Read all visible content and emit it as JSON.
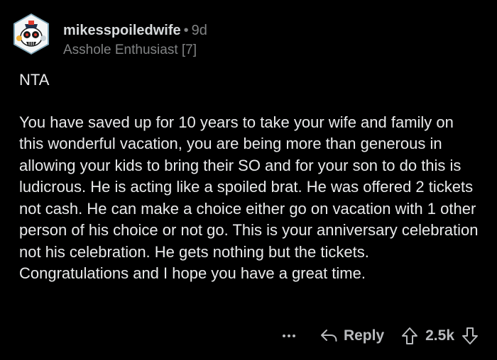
{
  "comment": {
    "username": "mikesspoiledwife",
    "separator": "•",
    "age": "9d",
    "flair": "Asshole Enthusiast [7]",
    "verdict": "NTA",
    "body": "You have saved up for 10 years to take your wife and family on this wonderful vacation, you are being more than generous in allowing your kids to bring their SO and for your son to do this is ludicrous. He is acting like a spoiled brat. He was offered 2 tickets not cash. He can make a choice either go on vacation with 1 other person of his choice or not go. This is your anniversary celebration not his celebration. He gets nothing but the tickets. Congratulations and I hope you have a great time."
  },
  "actions": {
    "more_icon": "more-dots-icon",
    "reply_icon": "reply-arrow-icon",
    "reply_label": "Reply",
    "upvote_icon": "upvote-arrow-icon",
    "score": "2.5k",
    "downvote_icon": "downvote-arrow-icon"
  },
  "colors": {
    "background": "#000000",
    "text": "#e9eaeb",
    "muted": "#818384",
    "avatar_ring": "#7fa6b8"
  }
}
